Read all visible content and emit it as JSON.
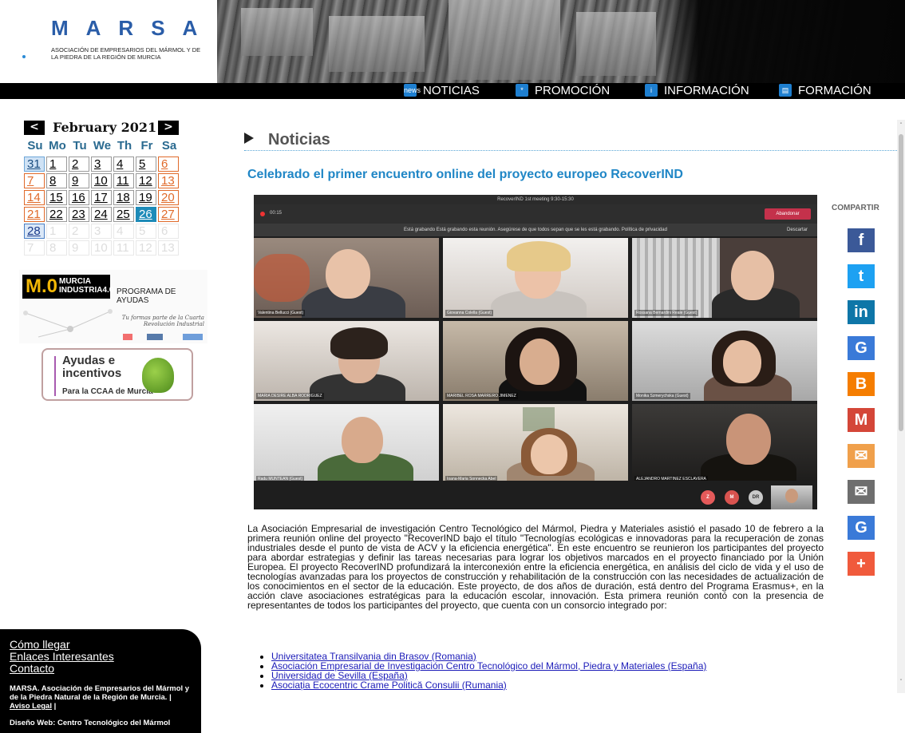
{
  "logo": {
    "letters": "MARSA",
    "subtitle": "ASOCIACIÓN DE EMPRESARIOS DEL MÁRMOL Y DE LA PIEDRA DE LA REGIÓN DE MURCIA"
  },
  "nav": [
    {
      "label": "NOTICIAS",
      "icon": "news"
    },
    {
      "label": "PROMOCIÓN",
      "icon": "*"
    },
    {
      "label": "INFORMACIÓN",
      "icon": "i"
    },
    {
      "label": "FORMACIÓN",
      "icon": "▤"
    }
  ],
  "calendar": {
    "prev": "<",
    "next": ">",
    "month": "February 2021",
    "dow": [
      "Su",
      "Mo",
      "Tu",
      "We",
      "Th",
      "Fr",
      "Sa"
    ],
    "weeks": [
      [
        "31",
        "1",
        "2",
        "3",
        "4",
        "5",
        "6"
      ],
      [
        "7",
        "8",
        "9",
        "10",
        "11",
        "12",
        "13"
      ],
      [
        "14",
        "15",
        "16",
        "17",
        "18",
        "19",
        "20"
      ],
      [
        "21",
        "22",
        "23",
        "24",
        "25",
        "26",
        "27"
      ],
      [
        "28",
        "1",
        "2",
        "3",
        "4",
        "5",
        "6"
      ],
      [
        "7",
        "8",
        "9",
        "10",
        "11",
        "12",
        "13"
      ]
    ]
  },
  "ads": {
    "murcia_logo": "M.0",
    "murcia_name": "MURCIA",
    "murcia_sub": "INDUSTRIA4.0",
    "programa": "PROGRAMA DE AYUDAS",
    "tagline": "Tu formas parte de la Cuarta Revolución Industrial",
    "ayudas_title": "Ayudas e incentivos",
    "ayudas_sub": "Para la CCAA de Murcia"
  },
  "footer": {
    "links": [
      "Cómo llegar",
      "Enlaces Interesantes",
      "Contacto"
    ],
    "org": "MARSA. Asociación de Empresarios del Mármol y de la Piedra Natural de la Región de Murcia. |",
    "legal": "Aviso Legal",
    "design": "Diseño Web: Centro Tecnológico del Mármol"
  },
  "main": {
    "section": "Noticias",
    "article_title": "Celebrado el primer encuentro online del proyecto europeo RecoverIND",
    "video": {
      "window_title": "RecoverIND 1st meeting 9:30-15:30",
      "timer": "00:15",
      "leave": "Abandonar",
      "notice": "Está grabando  Está grabando esta reunión. Asegúrese de que todos sepan que se les está grabando. Política de privacidad",
      "dismiss": "Descartar",
      "tiles": [
        "Valentina Bellucci (Guest)",
        "Giovanna Colella (Guest)",
        "Rossana Bernardini Reale (Guest)",
        "MARIA DESIRE ALBA RODRIGUEZ",
        "MARIBEL ROSA MARRERO JIMENEZ",
        "Monika Szmerychska (Guest)",
        "Radu MUNTEAN (Guest)",
        "Ioana-Maria Sonnecka Abel",
        "ALEJANDRO MARTINEZ ESCLAVERA"
      ],
      "avatars": [
        "Z",
        "M",
        "DR"
      ]
    },
    "body": "La Asociación Empresarial de investigación Centro Tecnológico del Mármol, Piedra y Materiales asistió el pasado 10 de febrero a la primera reunión online del proyecto \"RecoverIND bajo el título \"Tecnologías ecológicas e innovadoras para la recuperación de zonas industriales desde el punto de vista de ACV y la eficiencia energética\". En este encuentro se reunieron los participantes del proyecto para abordar estrategias y definir las tareas necesarias para lograr los objetivos marcados en el proyecto financiado por la Unión Europea. El proyecto RecoverIND profundizará la interconexión entre la eficiencia energética, en análisis del ciclo de vida y el uso de tecnologías avanzadas para los proyectos de construcción y rehabilitación de la construcción con las necesidades de actualización de los conocimientos en el sector de la educación. Este proyecto, de dos años de duración, está dentro del Programa Erasmus+, en la acción clave asociaciones estratégicas para la educación escolar, innovación. Esta primera reunión contó con la presencia de representantes de todos los participantes del proyecto, que cuenta con un consorcio integrado por:",
    "partners": [
      "Universitatea Transilvania din Brasov (Romania)",
      "Asociación Empresarial de Investigación Centro Tecnológico del Mármol, Piedra y Materiales (España)",
      "Universidad de Sevilla (España)",
      "Asociația Ecocentric Crame Politică Consulii (Rumania)"
    ]
  },
  "share": {
    "label": "COMPARTIR",
    "buttons": [
      {
        "name": "facebook",
        "glyph": "f",
        "color": "#3b5998"
      },
      {
        "name": "twitter",
        "glyph": "t",
        "color": "#1da1f2"
      },
      {
        "name": "linkedin",
        "glyph": "in",
        "color": "#0e76a8"
      },
      {
        "name": "google",
        "glyph": "G",
        "color": "#3a7ad8"
      },
      {
        "name": "blogger",
        "glyph": "B",
        "color": "#f57d00"
      },
      {
        "name": "gmail",
        "glyph": "M",
        "color": "#d44638"
      },
      {
        "name": "email",
        "glyph": "✉",
        "color": "#f0a04b"
      },
      {
        "name": "mail",
        "glyph": "✉",
        "color": "#6e6e6e"
      },
      {
        "name": "translate",
        "glyph": "G",
        "color": "#3a7ad8"
      },
      {
        "name": "more",
        "glyph": "+",
        "color": "#f05a3c"
      }
    ]
  }
}
